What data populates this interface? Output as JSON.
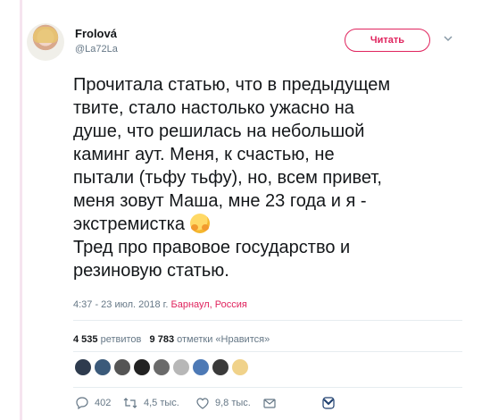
{
  "user": {
    "display_name": "Frolová",
    "handle": "@La72La"
  },
  "follow_button": {
    "label": "Читать"
  },
  "tweet": {
    "text": "Прочитала статью, что в предыдущем\nтвите, стало настолько ужасно на\nдуше, что решилась на небольшой\nкаминг аут. Меня, к счастью, не\nпытали (тьфу тьфу), но, всем привет,\nменя зовут Маша, мне 23 года и я -\nэкстремистка",
    "text_after_emoji": "\nТред про правовое государство и\nрезиновую статью.",
    "emoji_icon": "hugging-face-emoji"
  },
  "meta": {
    "time_date": "4:37 - 23 июл. 2018 г.",
    "place": "Барнаул, Россия"
  },
  "stats": {
    "retweets_count": "4 535",
    "retweets_label": "ретвитов",
    "likes_count": "9 783",
    "likes_label": "отметки «Нравится»"
  },
  "actions": {
    "reply_count": "402",
    "retweet_count": "4,5 тыс.",
    "like_count": "9,8 тыс."
  },
  "colors": {
    "accent_pink": "#e0245e",
    "muted_gray": "#657786"
  }
}
